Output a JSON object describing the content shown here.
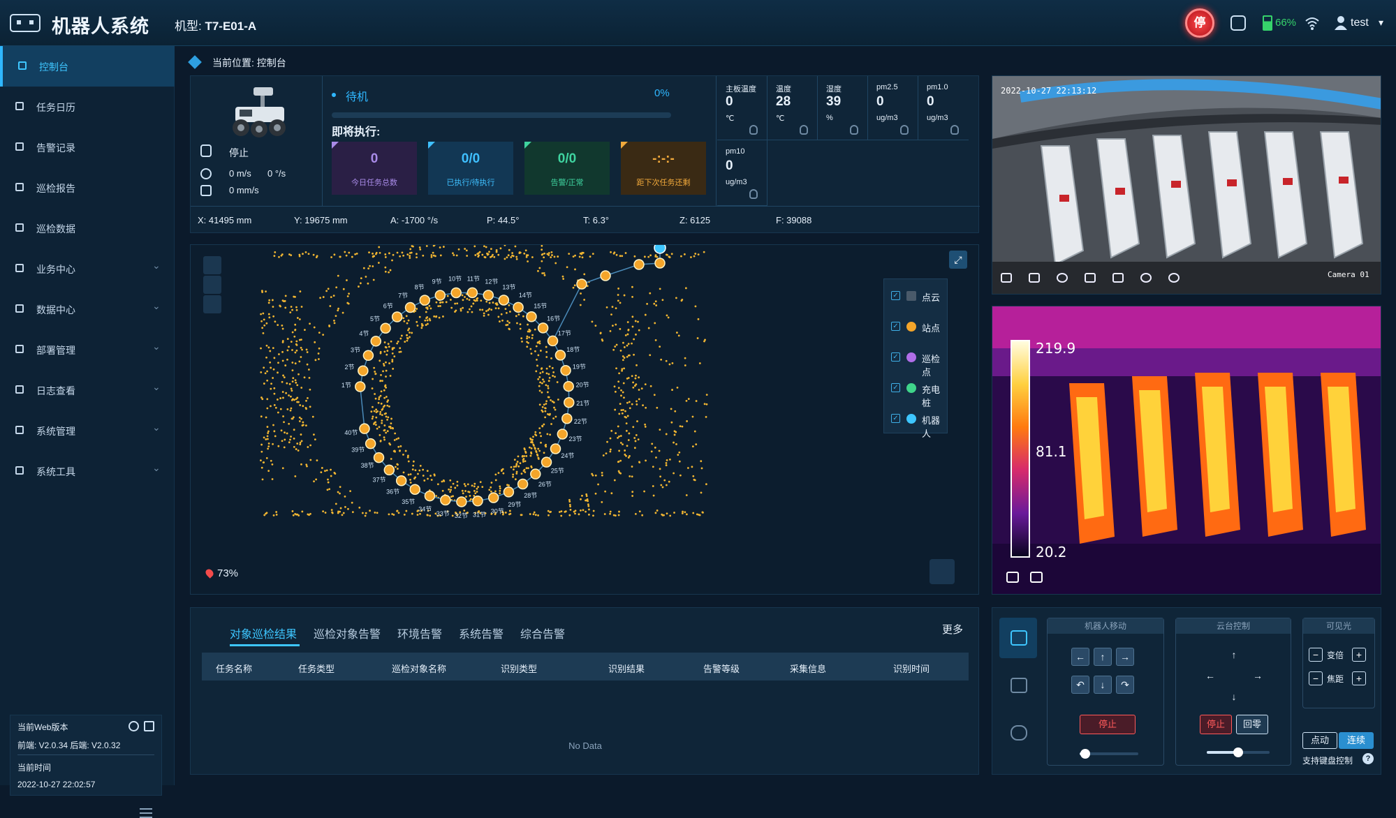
{
  "header": {
    "app_title": "机器人系统",
    "model_label": "机型:",
    "model_value": "T7-E01-A",
    "estop_label": "停",
    "battery": "66%",
    "user": "test"
  },
  "sidebar": {
    "items": [
      {
        "label": "控制台",
        "active": true,
        "icon": "monitor-icon"
      },
      {
        "label": "任务日历",
        "icon": "calendar-icon"
      },
      {
        "label": "告警记录",
        "icon": "alarm-icon"
      },
      {
        "label": "巡检报告",
        "icon": "report-icon"
      },
      {
        "label": "巡检数据",
        "icon": "data-icon"
      },
      {
        "label": "业务中心",
        "icon": "folder-icon",
        "chevron": true
      },
      {
        "label": "数据中心",
        "icon": "database-icon",
        "chevron": true
      },
      {
        "label": "部署管理",
        "icon": "deploy-icon",
        "chevron": true
      },
      {
        "label": "日志查看",
        "icon": "log-icon",
        "chevron": true
      },
      {
        "label": "系统管理",
        "icon": "settings-icon",
        "chevron": true
      },
      {
        "label": "系统工具",
        "icon": "tools-icon",
        "chevron": true
      }
    ],
    "version": {
      "title": "当前Web版本",
      "line": "前端:  V2.0.34 后端:  V2.0.32",
      "time_label": "当前时间",
      "time_value": "2022-10-27 22:02:57"
    }
  },
  "breadcrumb": "当前位置: 控制台",
  "status": {
    "state": "停止",
    "linear_speed": "0 m/s",
    "angular_speed": "0 °/s",
    "lift_speed": "0 mm/s",
    "mode": "待机",
    "progress": "0%",
    "progress_value": 0,
    "next_label": "即将执行:",
    "cards": [
      {
        "value": "0",
        "label": "今日任务总数"
      },
      {
        "value": "0/0",
        "label": "已执行/待执行"
      },
      {
        "value": "0/0",
        "label": "告警/正常"
      },
      {
        "value": "-:-:-",
        "label": "距下次任务还剩"
      }
    ],
    "sensors": [
      {
        "label": "主板温度",
        "value": "0",
        "unit": "℃"
      },
      {
        "label": "温度",
        "value": "28",
        "unit": "℃"
      },
      {
        "label": "湿度",
        "value": "39",
        "unit": "%"
      },
      {
        "label": "pm2.5",
        "value": "0",
        "unit": "ug/m3"
      },
      {
        "label": "pm1.0",
        "value": "0",
        "unit": "ug/m3"
      },
      {
        "label": "pm10",
        "value": "0",
        "unit": "ug/m3"
      }
    ],
    "coords": [
      "X:  41495 mm",
      "Y:  19675 mm",
      "A:  -1700 °/s",
      "P:  44.5°",
      "T:  6.3°",
      "Z:  6125",
      "F:  39088"
    ]
  },
  "map": {
    "zoom": "73%",
    "legend": [
      {
        "label": "点云",
        "color": "#4a5a6a"
      },
      {
        "label": "站点",
        "color": "#f4a52a"
      },
      {
        "label": "巡检点",
        "color": "#b06ee8"
      },
      {
        "label": "充电桩",
        "color": "#3fd48a"
      },
      {
        "label": "机器人",
        "color": "#3ec6ff"
      }
    ],
    "station_labels": [
      "1节",
      "2节",
      "3节",
      "4节",
      "5节",
      "6节",
      "7节",
      "8节",
      "9节",
      "10节",
      "11节",
      "12节",
      "13节",
      "14节",
      "15节",
      "16节",
      "17节",
      "18节",
      "19节",
      "20节",
      "21节",
      "22节",
      "23节",
      "24节",
      "25节",
      "26节",
      "28节",
      "29节",
      "30节",
      "31节",
      "32节",
      "33节",
      "34节",
      "35节",
      "36节",
      "37节",
      "38节",
      "39节",
      "40节"
    ]
  },
  "camera": {
    "timestamp": "2022-10-27 22:13:12",
    "label": "Camera 01"
  },
  "thermal": {
    "max": "219.9",
    "mid": "81.1",
    "min": "20.2"
  },
  "table": {
    "tabs": [
      "对象巡检结果",
      "巡检对象告警",
      "环境告警",
      "系统告警",
      "综合告警"
    ],
    "more": "更多",
    "columns": [
      "任务名称",
      "任务类型",
      "巡检对象名称",
      "识别类型",
      "识别结果",
      "告警等级",
      "采集信息",
      "识别时间"
    ],
    "empty": "No Data"
  },
  "control": {
    "move_title": "机器人移动",
    "ptz_title": "云台控制",
    "visible_title": "可见光",
    "stop": "停止",
    "home": "回零",
    "zoom_label": "变倍",
    "focus_label": "焦距",
    "mode_jog": "点动",
    "mode_cont": "连续",
    "keyboard": "支持键盘控制",
    "move_speed": 0.1,
    "ptz_speed": 0.5
  }
}
